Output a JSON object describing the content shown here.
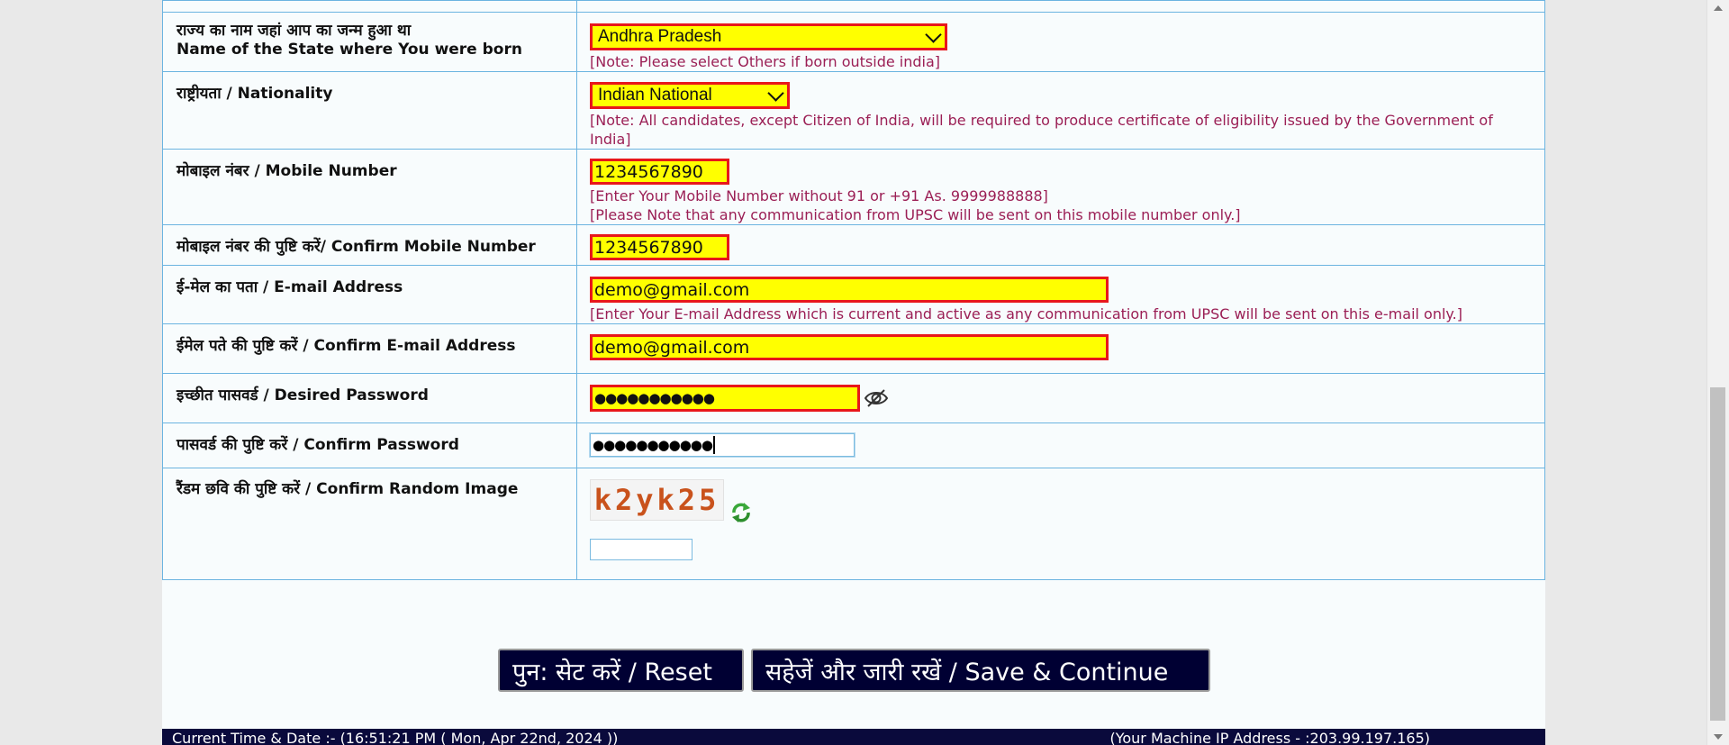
{
  "form": {
    "state_label_hi": "राज्य का नाम जहां आप का जन्म हुआ था",
    "state_label_en": "Name of the State where You were born",
    "state_value": "Andhra Pradesh",
    "state_note": "[Note: Please select Others if born outside india]",
    "nationality_label": "राष्ट्रीयता / Nationality",
    "nationality_value": "Indian National",
    "nationality_note": "[Note: All candidates, except Citizen of India, will be required to produce certificate of eligibility issued by the Government of India]",
    "mobile_label": "मोबाइल नंबर / Mobile Number",
    "mobile_value": "1234567890",
    "mobile_note1": "[Enter Your Mobile Number without 91 or +91 As. 9999988888]",
    "mobile_note2": "[Please Note that any communication from UPSC will be sent on this mobile number only.]",
    "confirm_mobile_label": "मोबाइल नंबर की पुष्टि करें/ Confirm Mobile Number",
    "confirm_mobile_value": "1234567890",
    "email_label": "ई-मेल का पता / E-mail Address",
    "email_value": "demo@gmail.com",
    "email_note": "[Enter Your E-mail Address which is current and active as any communication from UPSC will be sent on this e-mail only.]",
    "confirm_email_label": "ईमेल पते की पुष्टि करें / Confirm E-mail Address",
    "confirm_email_value": "demo@gmail.com",
    "password_label": "इच्छीत पासवर्ड / Desired Password",
    "password_value": "●●●●●●●●●●●",
    "confirm_password_label": "पासवर्ड की पुष्टि करें / Confirm Password",
    "confirm_password_value": "●●●●●●●●●●●",
    "captcha_label": "रैंडम छवि की पुष्टि करें / Confirm Random Image",
    "captcha_text": "k2yk25",
    "captcha_input_value": ""
  },
  "buttons": {
    "reset": "पुन: सेट करें / Reset",
    "save": "सहेजें और जारी रखें / Save & Continue"
  },
  "footer": {
    "time": "Current Time & Date :- (16:51:21 PM ( Mon, Apr 22nd, 2024 ))",
    "ip": "(Your Machine IP  Address - :203.99.197.165)"
  },
  "colors": {
    "field_bg": "#ffff00",
    "field_border": "#e8171b",
    "note": "#9b1f55",
    "button_bg": "#000033",
    "table_border": "#6cb4e0"
  },
  "icons": {
    "eye": "eye-slash-icon",
    "refresh": "refresh-icon"
  }
}
